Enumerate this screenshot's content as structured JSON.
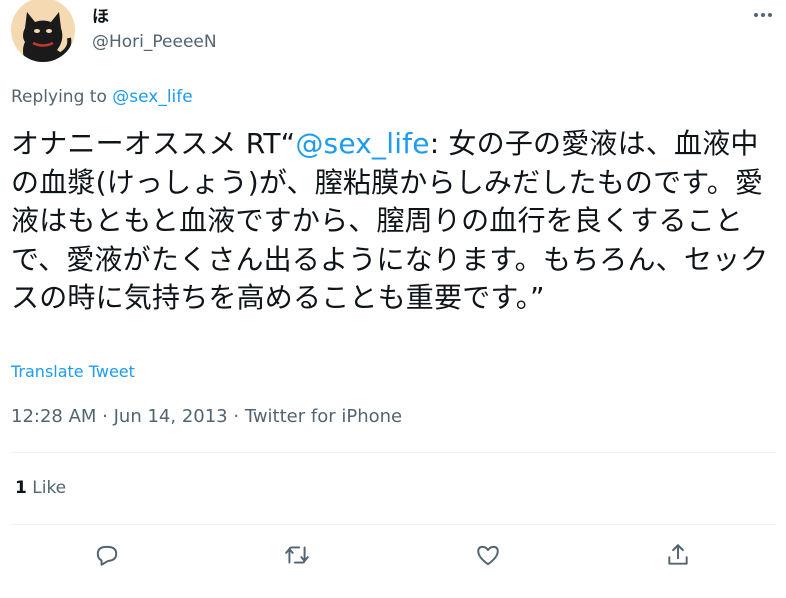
{
  "author": {
    "display_name": "ほ",
    "handle": "@Hori_PeeeeN",
    "avatar_icon": "black-cat-avatar-icon"
  },
  "more_icon": "more-options-icon",
  "replying": {
    "prefix": "Replying to ",
    "mention": "@sex_life"
  },
  "tweet": {
    "text_before": "オナニーオススメ RT“",
    "mention": "@sex_life",
    "text_after": ": 女の子の愛液は、血液中の血漿(けっしょう)が、膣粘膜からしみだしたものです。愛液はもともと血液ですから、膣周りの血行を良くすることで、愛液がたくさん出るようになります。もちろん、セックスの時に気持ちを高めることも重要です。”"
  },
  "translate_label": "Translate Tweet",
  "meta": {
    "time": "12:28 AM",
    "separator": " · ",
    "date": "Jun 14, 2013",
    "source": "Twitter for iPhone"
  },
  "stats": {
    "likes_count": "1",
    "likes_label": " Like"
  },
  "actions": [
    "reply-icon",
    "retweet-icon",
    "like-icon",
    "share-icon"
  ],
  "colors": {
    "accent": "#1d9bf0",
    "secondary_text": "#536471",
    "primary_text": "#0f1419",
    "divider": "#eff3f4"
  }
}
